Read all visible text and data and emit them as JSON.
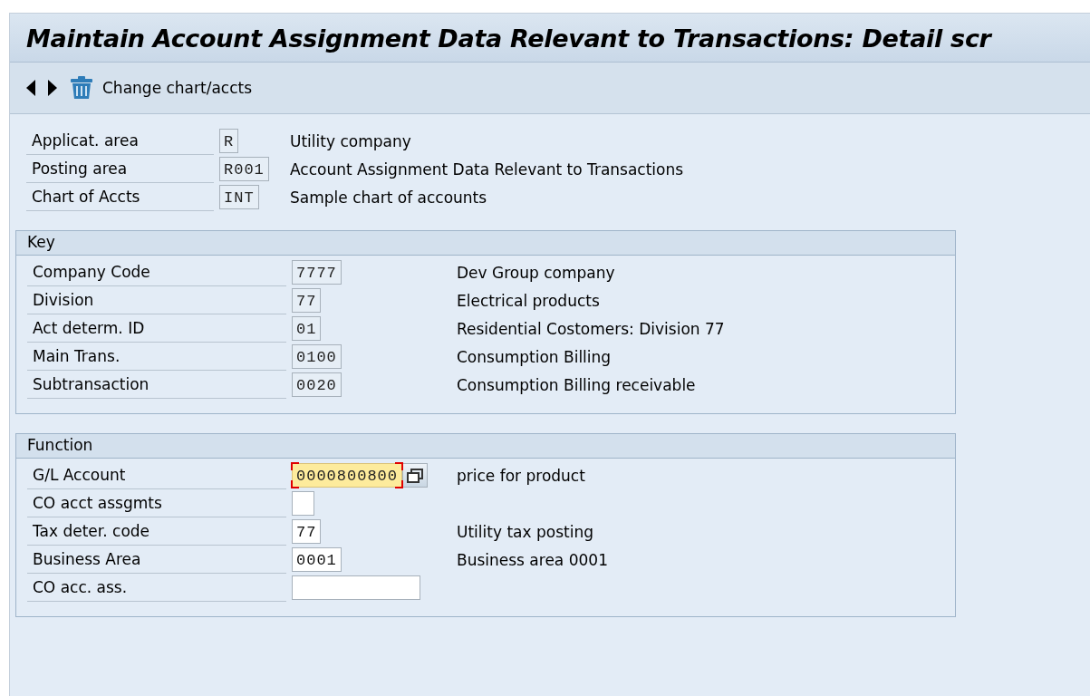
{
  "window": {
    "title": "Maintain Account Assignment Data Relevant to Transactions: Detail scr"
  },
  "toolbar": {
    "button": "Change chart/accts"
  },
  "header_fields": [
    {
      "label": "Applicat. area",
      "value": "R",
      "kind": "display",
      "description": "Utility company"
    },
    {
      "label": "Posting area",
      "value": "R001",
      "kind": "display",
      "description": "Account Assignment Data Relevant to Transactions"
    },
    {
      "label": "Chart of Accts",
      "value": "INT",
      "kind": "display",
      "description": "Sample chart of accounts"
    }
  ],
  "groups": [
    {
      "title": "Key",
      "fields": [
        {
          "label": "Company Code",
          "value": "7777",
          "kind": "display",
          "description": "Dev Group company"
        },
        {
          "label": "Division",
          "value": "77",
          "kind": "display",
          "description": "Electrical products"
        },
        {
          "label": "Act determ. ID",
          "value": "01",
          "kind": "display",
          "description": "Residential Costomers: Division 77"
        },
        {
          "label": "Main Trans.",
          "value": "0100",
          "kind": "display",
          "description": "Consumption Billing"
        },
        {
          "label": "Subtransaction",
          "value": "0020",
          "kind": "display",
          "description": "Consumption Billing receivable"
        }
      ]
    },
    {
      "title": "Function",
      "fields": [
        {
          "label": "G/L Account",
          "value": "0000800800",
          "kind": "focused",
          "description": "price for product"
        },
        {
          "label": "CO acct assgmts",
          "kind": "flag"
        },
        {
          "label": "Tax deter. code",
          "value": "77",
          "kind": "input",
          "description": "Utility tax posting"
        },
        {
          "label": "Business Area",
          "value": "0001",
          "kind": "input",
          "description": "Business area 0001"
        },
        {
          "label": "CO acc. ass.",
          "kind": "blank"
        }
      ]
    }
  ]
}
